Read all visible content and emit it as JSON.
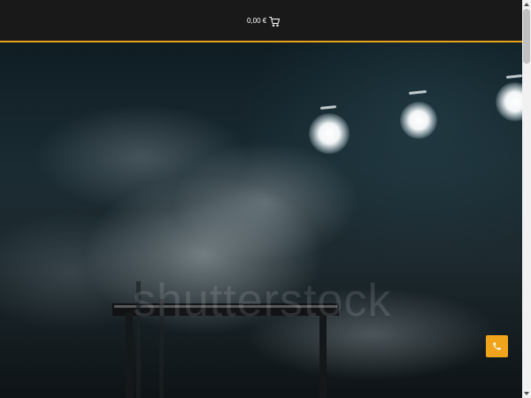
{
  "header": {
    "cart_total": "0,00 €",
    "cart_icon": "shopping-cart-icon"
  },
  "hero": {
    "watermark": "shutterstock"
  },
  "floating": {
    "phone_icon": "phone-icon"
  },
  "colors": {
    "accent": "#e9a21a",
    "header_bg": "#1a1919",
    "phone_button_bg": "#f0a41c"
  }
}
